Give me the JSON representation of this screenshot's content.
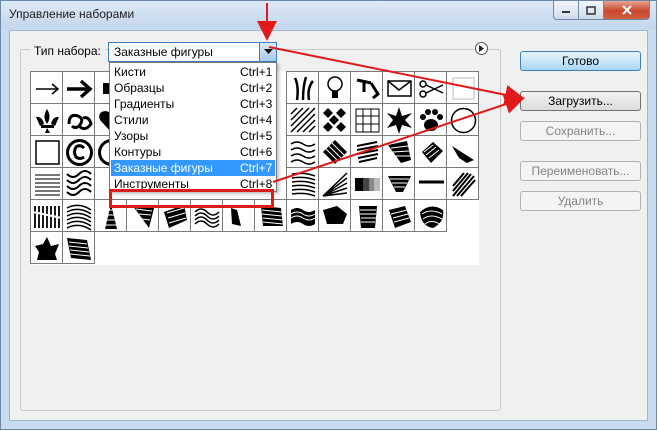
{
  "window": {
    "title": "Управление наборами",
    "controls": [
      "minimize-icon",
      "maximize-icon",
      "close-icon"
    ]
  },
  "preset": {
    "label": "Тип набора:",
    "value": "Заказные фигуры",
    "options": [
      {
        "label": "Кисти",
        "shortcut": "Ctrl+1"
      },
      {
        "label": "Образцы",
        "shortcut": "Ctrl+2"
      },
      {
        "label": "Градиенты",
        "shortcut": "Ctrl+3"
      },
      {
        "label": "Стили",
        "shortcut": "Ctrl+4"
      },
      {
        "label": "Узоры",
        "shortcut": "Ctrl+5"
      },
      {
        "label": "Контуры",
        "shortcut": "Ctrl+6"
      },
      {
        "label": "Заказные фигуры",
        "shortcut": "Ctrl+7"
      },
      {
        "label": "Инструменты",
        "shortcut": "Ctrl+8"
      }
    ],
    "selected_index": 6
  },
  "buttons": {
    "done": "Готово",
    "load": "Загрузить...",
    "save": "Сохранить...",
    "rename": "Переименовать...",
    "delete": "Удалить"
  },
  "shapes": {
    "row1": [
      "arrow-thin-icon",
      "arrow-bold-icon",
      "rectangle-icon",
      "",
      "",
      "",
      "",
      "",
      "",
      "grass-icon",
      "lightbulb-icon",
      "note-icon",
      "envelope-icon",
      "scissors-icon",
      "blank-square-icon"
    ],
    "row2": [
      "fleur-de-lis-icon",
      "ornament-icon",
      "heart-icon",
      "",
      "",
      "",
      "",
      "",
      "hatch-pattern-icon",
      "diamond-grid-icon",
      "grid-icon",
      "starburst-icon",
      "paw-print-icon",
      "circle-icon"
    ],
    "row3": [
      "square-frame-icon",
      "copyright-icon",
      "registered-icon",
      "",
      "",
      "",
      "",
      "",
      "wave-pattern-icon",
      "tilted-square-icon",
      "stripes-icon",
      "shard-icon",
      "tile-icon",
      "shard-icon"
    ],
    "row4": [
      "lines-icon",
      "wave-tile-icon",
      "",
      "",
      "",
      "",
      "",
      "",
      "stripes-icon",
      "fan-icon",
      "gradient-bar-icon",
      "funnel-icon",
      "line-icon",
      "diagonal-tile-icon"
    ],
    "row5": [
      "fan-lines-icon",
      "wave-lines-icon",
      "tower-icon",
      "flag-icon",
      "patch-icon",
      "wave-icon",
      "shard-icon",
      "tile-icon",
      "wave-icon",
      "patch-icon",
      "stripes-icon",
      "tile-icon",
      "blob-icon"
    ],
    "row6": [
      "burst-icon",
      "tile-icon"
    ],
    "total": 83
  },
  "annotations": {
    "color": "#e01a1a"
  }
}
